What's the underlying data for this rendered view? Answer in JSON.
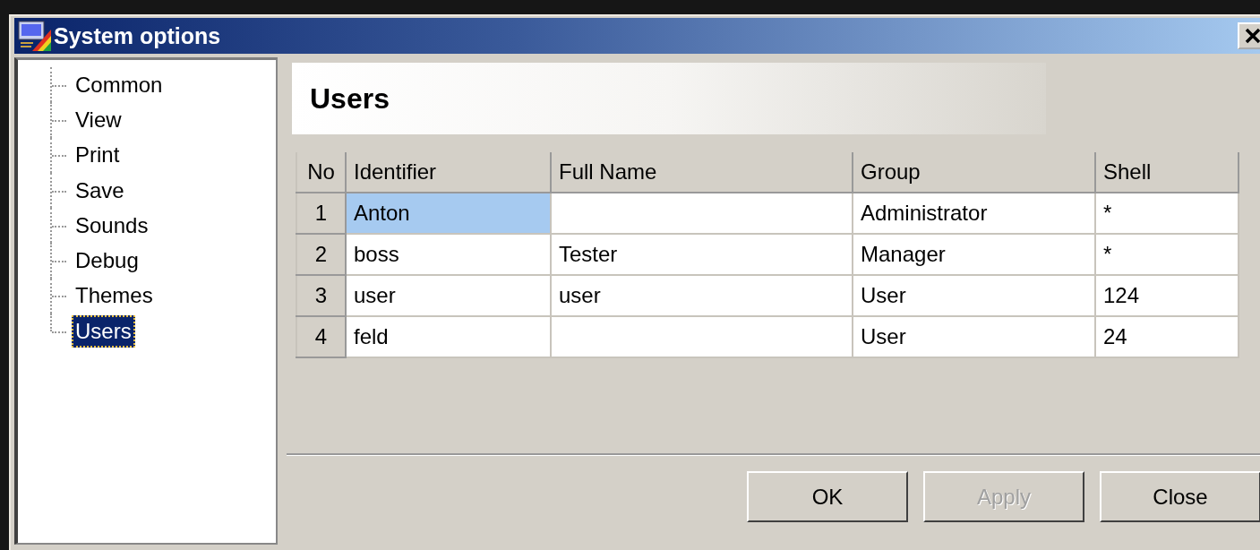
{
  "window": {
    "title": "System options"
  },
  "tree": {
    "items": [
      {
        "label": "Common",
        "selected": false
      },
      {
        "label": "View",
        "selected": false
      },
      {
        "label": "Print",
        "selected": false
      },
      {
        "label": "Save",
        "selected": false
      },
      {
        "label": "Sounds",
        "selected": false
      },
      {
        "label": "Debug",
        "selected": false
      },
      {
        "label": "Themes",
        "selected": false
      },
      {
        "label": "Users",
        "selected": true
      }
    ]
  },
  "page": {
    "heading": "Users"
  },
  "table": {
    "columns": [
      "No",
      "Identifier",
      "Full Name",
      "Group",
      "Shell"
    ],
    "rows": [
      {
        "cells": [
          "1",
          "Anton",
          "",
          "Administrator",
          "*"
        ],
        "selected": true
      },
      {
        "cells": [
          "2",
          "boss",
          "Tester",
          "Manager",
          "*"
        ],
        "selected": false
      },
      {
        "cells": [
          "3",
          "user",
          "user",
          "User",
          "124"
        ],
        "selected": false
      },
      {
        "cells": [
          "4",
          "feld",
          "",
          "User",
          "24"
        ],
        "selected": false
      }
    ]
  },
  "buttons": [
    {
      "label": "OK",
      "disabled": false
    },
    {
      "label": "Apply",
      "disabled": true
    },
    {
      "label": "Close",
      "disabled": false
    }
  ]
}
